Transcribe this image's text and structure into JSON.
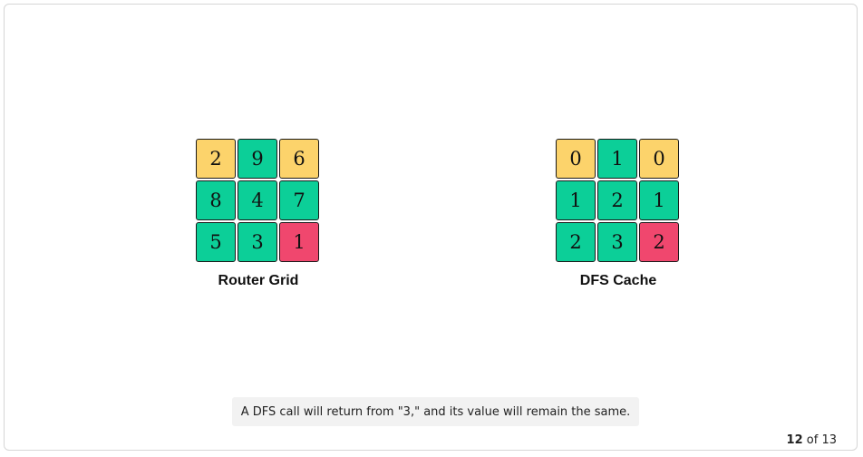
{
  "colors": {
    "yellow": "#fcd36b",
    "green": "#0ccf98",
    "red": "#f0476e"
  },
  "router_grid": {
    "label": "Router Grid",
    "cells": [
      {
        "value": "2",
        "color": "yellow"
      },
      {
        "value": "9",
        "color": "green"
      },
      {
        "value": "6",
        "color": "yellow"
      },
      {
        "value": "8",
        "color": "green"
      },
      {
        "value": "4",
        "color": "green"
      },
      {
        "value": "7",
        "color": "green"
      },
      {
        "value": "5",
        "color": "green"
      },
      {
        "value": "3",
        "color": "green"
      },
      {
        "value": "1",
        "color": "red"
      }
    ]
  },
  "dfs_cache": {
    "label": "DFS Cache",
    "cells": [
      {
        "value": "0",
        "color": "yellow"
      },
      {
        "value": "1",
        "color": "green"
      },
      {
        "value": "0",
        "color": "yellow"
      },
      {
        "value": "1",
        "color": "green"
      },
      {
        "value": "2",
        "color": "green"
      },
      {
        "value": "1",
        "color": "green"
      },
      {
        "value": "2",
        "color": "green"
      },
      {
        "value": "3",
        "color": "green"
      },
      {
        "value": "2",
        "color": "red"
      }
    ]
  },
  "caption": "A DFS call will return from \"3,\" and its value will remain the same.",
  "pager": {
    "current": "12",
    "separator": "of",
    "total": "13"
  }
}
